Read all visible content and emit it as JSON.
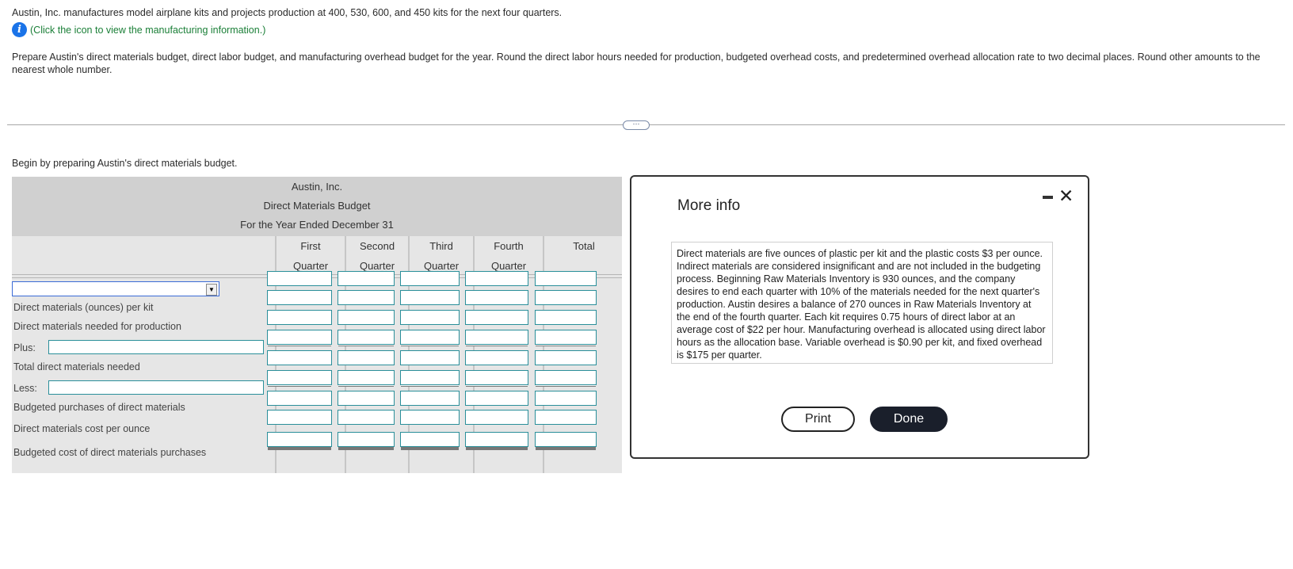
{
  "problem": {
    "intro": "Austin, Inc. manufactures model airplane kits and projects production at 400, 530, 600, and 450 kits for the next four quarters.",
    "info_link": "(Click the icon to view the manufacturing information.)",
    "instructions": "Prepare Austin's direct materials budget, direct labor budget, and manufacturing overhead budget for the year. Round the direct labor hours needed for production, budgeted overhead costs, and predetermined overhead allocation rate to two decimal places. Round other amounts to the nearest whole number.",
    "more_button": "⋯",
    "begin": "Begin by preparing Austin's direct materials budget."
  },
  "budget": {
    "company": "Austin, Inc.",
    "title": "Direct Materials Budget",
    "period": "For the Year Ended December 31",
    "columns": [
      {
        "line1": "First",
        "line2": "Quarter"
      },
      {
        "line1": "Second",
        "line2": "Quarter"
      },
      {
        "line1": "Third",
        "line2": "Quarter"
      },
      {
        "line1": "Fourth",
        "line2": "Quarter"
      },
      {
        "line1": "",
        "line2": "Total"
      }
    ],
    "dropdown_value": "",
    "rows": {
      "dm_per_kit": "Direct materials (ounces) per kit",
      "dm_needed": "Direct materials needed for production",
      "plus": "Plus:",
      "total_needed": "Total direct materials needed",
      "less": "Less:",
      "purchases": "Budgeted purchases of direct materials",
      "cost_per_ounce": "Direct materials cost per ounce",
      "budgeted_cost": "Budgeted cost of direct materials purchases"
    }
  },
  "modal": {
    "title": "More info",
    "text": "Direct materials are five ounces of plastic per kit and the plastic costs $3 per ounce. Indirect materials are considered insignificant and are not included in the budgeting process. Beginning Raw Materials Inventory is 930 ounces, and the company desires to end each quarter with 10% of the materials needed for the next quarter's production. Austin desires a balance of 270 ounces in Raw Materials Inventory at the end of the fourth quarter. Each kit requires 0.75 hours of direct labor at an average cost of $22 per hour. Manufacturing overhead is allocated using direct labor hours as the allocation base. Variable overhead is $0.90 per kit, and fixed overhead is $175 per quarter.",
    "print_label": "Print",
    "done_label": "Done",
    "close_glyph": "✕"
  }
}
